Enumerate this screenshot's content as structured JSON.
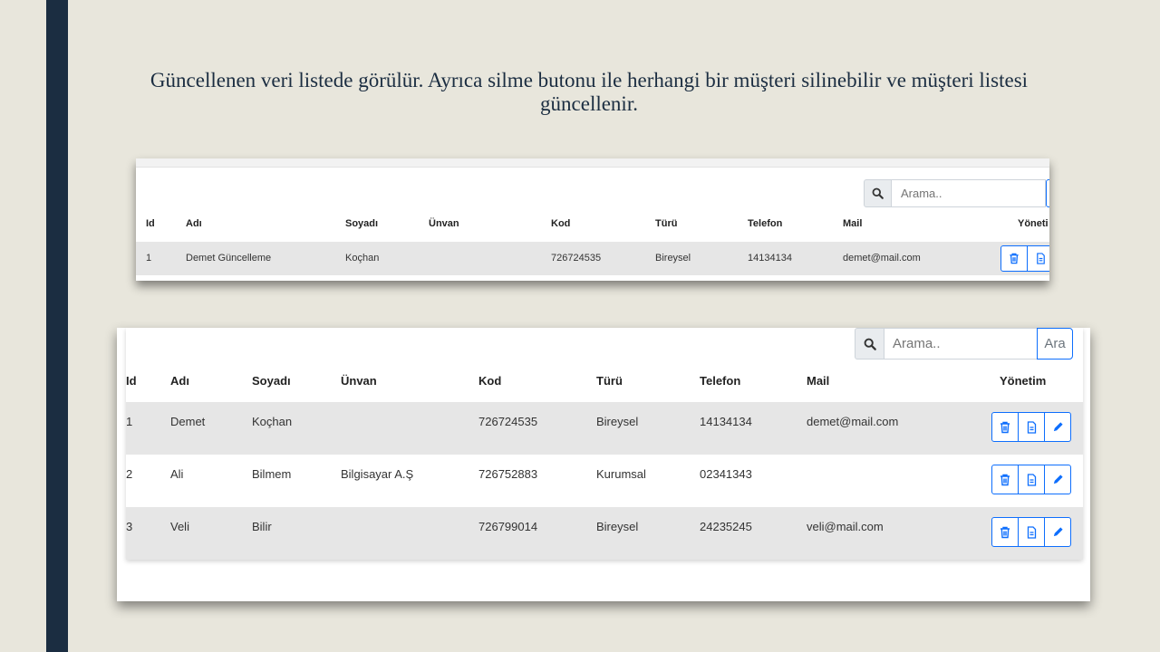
{
  "caption": "Güncellenen veri listede görülür. Ayrıca silme butonu ile herhangi bir müşteri silinebilir ve müşteri listesi güncellenir.",
  "colors": {
    "accent": "#0d6efd",
    "sidebar": "#1b2d41",
    "background": "#e8e6dc",
    "row_alt": "#e6e6e6"
  },
  "screenshot1": {
    "search_placeholder": "Arama..",
    "columns": {
      "id": "Id",
      "adi": "Adı",
      "soyadi": "Soyadı",
      "unvan": "Ünvan",
      "kod": "Kod",
      "turu": "Türü",
      "telefon": "Telefon",
      "mail": "Mail",
      "yonetim": "Yöneti"
    },
    "rows": [
      {
        "id": "1",
        "adi": "Demet Güncelleme",
        "soyadi": "Koçhan",
        "unvan": "",
        "kod": "726724535",
        "turu": "Bireysel",
        "telefon": "14134134",
        "mail": "demet@mail.com"
      }
    ],
    "icons": [
      "search-icon",
      "trash-icon",
      "document-icon"
    ]
  },
  "screenshot2": {
    "search_placeholder": "Arama..",
    "search_button": "Ara",
    "columns": {
      "id": "Id",
      "adi": "Adı",
      "soyadi": "Soyadı",
      "unvan": "Ünvan",
      "kod": "Kod",
      "turu": "Türü",
      "telefon": "Telefon",
      "mail": "Mail",
      "yonetim": "Yönetim"
    },
    "rows": [
      {
        "id": "1",
        "adi": "Demet",
        "soyadi": "Koçhan",
        "unvan": "",
        "kod": "726724535",
        "turu": "Bireysel",
        "telefon": "14134134",
        "mail": "demet@mail.com"
      },
      {
        "id": "2",
        "adi": "Ali",
        "soyadi": "Bilmem",
        "unvan": "Bilgisayar A.Ş",
        "kod": "726752883",
        "turu": "Kurumsal",
        "telefon": "02341343",
        "mail": ""
      },
      {
        "id": "3",
        "adi": "Veli",
        "soyadi": "Bilir",
        "unvan": "",
        "kod": "726799014",
        "turu": "Bireysel",
        "telefon": "24235245",
        "mail": "veli@mail.com"
      }
    ],
    "icons": [
      "search-icon",
      "trash-icon",
      "document-icon",
      "pencil-icon"
    ]
  }
}
